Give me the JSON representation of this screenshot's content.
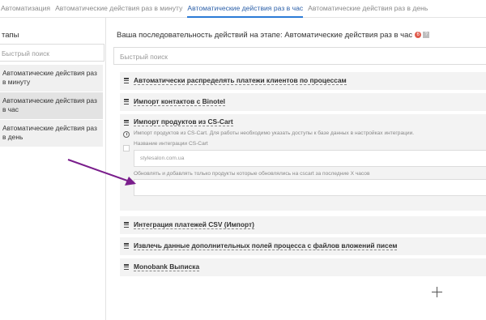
{
  "tabs": [
    {
      "label": "Автоматизация"
    },
    {
      "label": "Автоматические действия раз в минуту"
    },
    {
      "label": "Автоматические действия раз в час"
    },
    {
      "label": "Автоматические действия раз в день"
    }
  ],
  "active_tab_index": 2,
  "left": {
    "header": "тапы",
    "search_placeholder": "Быстрый поиск",
    "stages": [
      {
        "label": "Автоматические действия раз в минуту"
      },
      {
        "label": "Автоматические действия раз в час"
      },
      {
        "label": "Автоматические действия раз в день"
      }
    ]
  },
  "main": {
    "title": "Ваша последовательность действий на этапе: Автоматические действия раз в час",
    "badge": "6",
    "help": "?",
    "search_placeholder": "Быстрый поиск",
    "actions_before": [
      {
        "name": "Автоматически распределять платежи клиентов по процессам"
      },
      {
        "name": "Импорт контактов с Binotel"
      }
    ],
    "expanded_action": {
      "name": "Импорт продуктов из CS-Cart",
      "description": "Импорт продуктов из CS-Cart. Для работы необходимо указать доступы к базе данных в настройках интеграции.",
      "integration_label": "Название интеграции CS-Cart",
      "integration_value": "stylesalon.com.ua",
      "hours_label": "Обновлять и добавлять только продукты которые обновлялись на cscart за последние X часов",
      "hours_value": ""
    },
    "actions_after": [
      {
        "name": "Интеграция платежей CSV (Импорт)"
      },
      {
        "name": "Извлечь данные дополнительных полей процесса с файлов вложений писем"
      },
      {
        "name": "Monobank Выписка"
      }
    ]
  },
  "colors": {
    "active_tab": "#2b7bd6",
    "badge": "#e05a4b",
    "annotation_arrow": "#7a1e8c"
  }
}
